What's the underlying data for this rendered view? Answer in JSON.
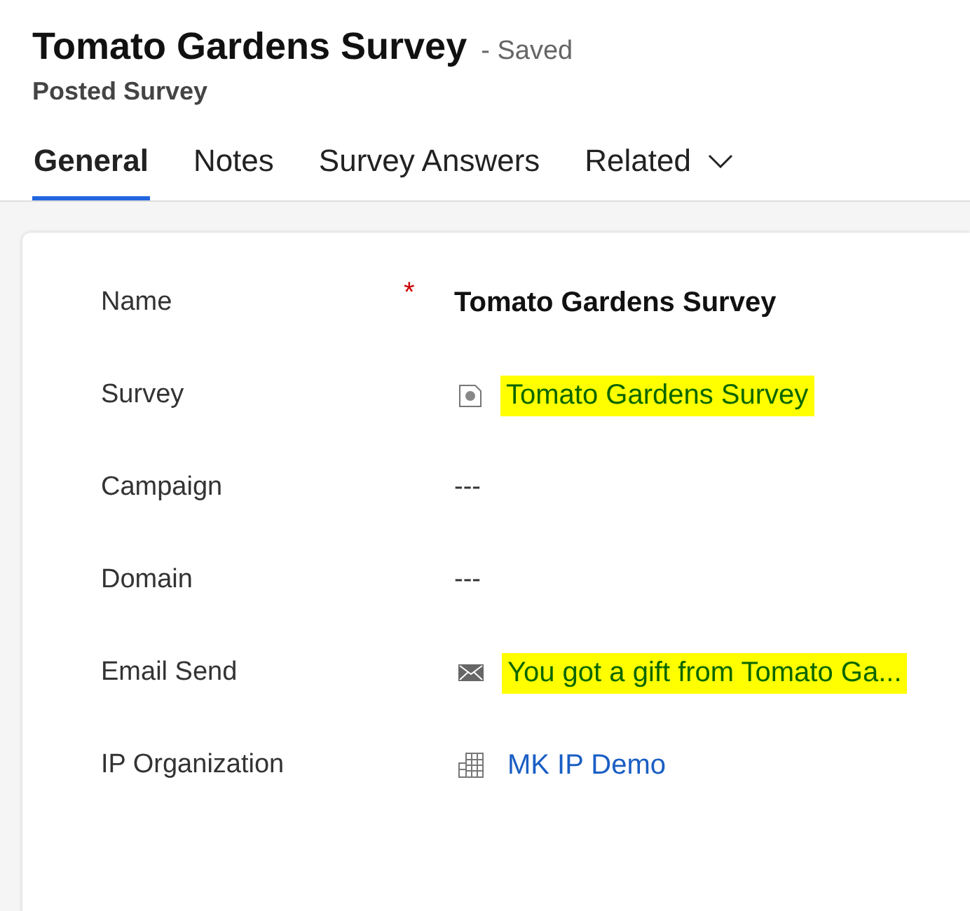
{
  "header": {
    "title": "Tomato Gardens Survey",
    "save_status": "- Saved",
    "entity_type": "Posted Survey"
  },
  "tabs": [
    {
      "label": "General",
      "selected": true,
      "kind": "tab"
    },
    {
      "label": "Notes",
      "selected": false,
      "kind": "tab"
    },
    {
      "label": "Survey Answers",
      "selected": false,
      "kind": "tab"
    },
    {
      "label": "Related",
      "selected": false,
      "kind": "menu"
    }
  ],
  "fields": [
    {
      "label": "Name",
      "required_marker": "*",
      "kind": "text",
      "value": "Tomato Gardens Survey"
    },
    {
      "label": "Survey",
      "kind": "survey",
      "value": "Tomato Gardens Survey",
      "highlighted": true
    },
    {
      "label": "Campaign",
      "kind": "empty",
      "value": "---"
    },
    {
      "label": "Domain",
      "kind": "empty",
      "value": "---"
    },
    {
      "label": "Email Send",
      "kind": "email",
      "value": "You got a gift from Tomato Ga...",
      "highlighted": true
    },
    {
      "label": "IP Organization",
      "kind": "organization",
      "value": "MK IP Demo",
      "highlighted": false
    }
  ]
}
